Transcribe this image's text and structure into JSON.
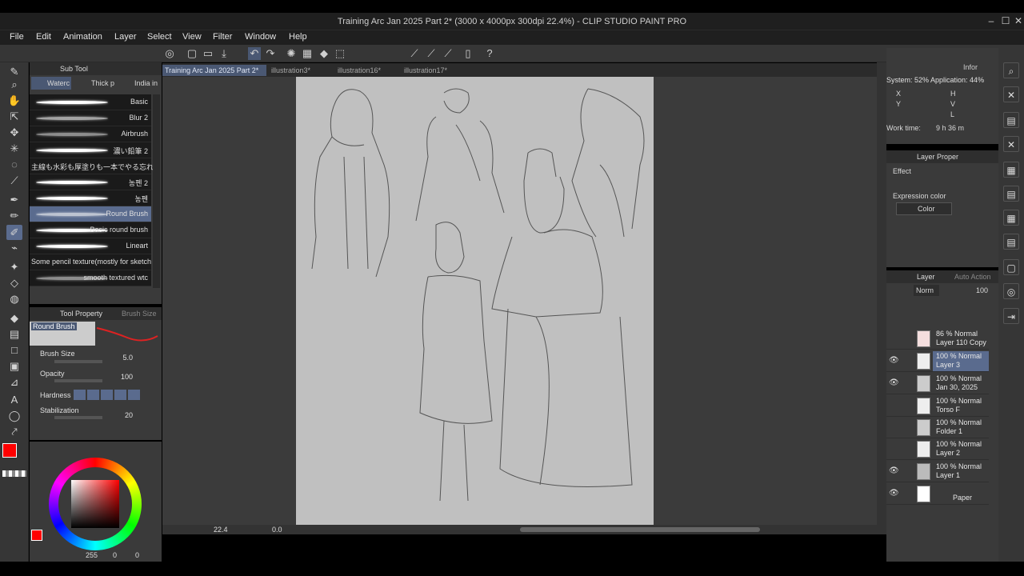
{
  "window": {
    "title": "Training Arc Jan 2025 Part 2* (3000 x 4000px 300dpi 22.4%) - CLIP STUDIO PAINT PRO"
  },
  "menu": [
    "File",
    "Edit",
    "Animation",
    "Layer",
    "Select",
    "View",
    "Filter",
    "Window",
    "Help"
  ],
  "tabs": [
    "Training Arc Jan 2025 Part 2*",
    "illustration3*",
    "illustration16*",
    "illustration17*"
  ],
  "subtool": {
    "header": "Sub Tool",
    "groups": [
      "Waterc",
      "Thick p",
      "India in"
    ],
    "brushes": [
      "Basic",
      "Blur 2",
      "Airbrush",
      "濃い鉛筆 2",
      "主線も水彩も厚塗りも一本でやる忘れ",
      "농펜 2",
      "농펜",
      "Round Brush",
      "Basic round brush",
      "Lineart",
      "Some pencil texture(mostly for sketch",
      "smooth textured wtc"
    ]
  },
  "toolprop": {
    "header": "Tool Property",
    "tab2": "Brush Size",
    "brush_name": "Round Brush",
    "params": [
      {
        "label": "Brush Size",
        "value": "5.0"
      },
      {
        "label": "Opacity",
        "value": "100"
      },
      {
        "label": "Hardness",
        "value": ""
      },
      {
        "label": "Stabilization",
        "value": "20"
      }
    ]
  },
  "color": {
    "r": "255",
    "g": "0",
    "b": "0",
    "main": "#ff0000"
  },
  "status": {
    "zoom": "22.4",
    "angle": "0.0"
  },
  "info": {
    "system": "System: 52%  Application: 44%",
    "x": "X",
    "y": "Y",
    "h": "H",
    "v": "V",
    "l": "L",
    "worktime_label": "Work time:",
    "worktime": "9 h 36 m",
    "tab": "Infor"
  },
  "layerprop": {
    "header": "Layer Proper",
    "effect": "Effect",
    "expression": "Expression color",
    "color_mode": "Color"
  },
  "layers": {
    "header": "Layer",
    "auto_action": "Auto Action",
    "blend": "Norm",
    "opacity": "100",
    "items": [
      {
        "mode": "86 % Normal",
        "name": "Layer 110 Copy"
      },
      {
        "mode": "100 % Normal",
        "name": "Layer 3"
      },
      {
        "mode": "100 % Normal",
        "name": "Jan 30, 2025"
      },
      {
        "mode": "100 % Normal",
        "name": "Torso F"
      },
      {
        "mode": "100 % Normal",
        "name": "Folder 1"
      },
      {
        "mode": "100 % Normal",
        "name": "Layer 2"
      },
      {
        "mode": "100 % Normal",
        "name": "Layer 1"
      },
      {
        "mode": "",
        "name": "Paper"
      }
    ]
  }
}
